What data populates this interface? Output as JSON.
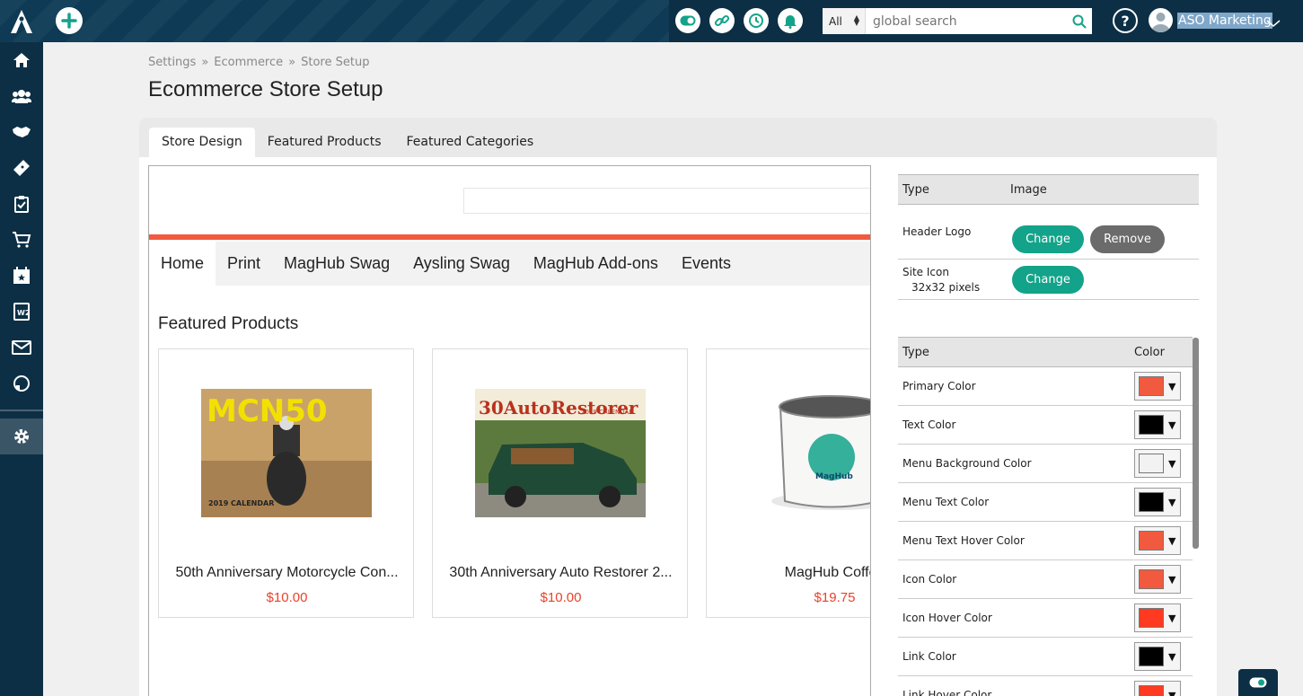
{
  "header": {
    "search_scope": "All",
    "search_placeholder": "global search",
    "user_name": "ASO Marketing",
    "help_label": "?"
  },
  "breadcrumb": [
    "Settings",
    "»",
    "Ecommerce",
    "»",
    "Store Setup"
  ],
  "page_title": "Ecommerce Store Setup",
  "tabs": [
    "Store Design",
    "Featured Products",
    "Featured Categories"
  ],
  "preview": {
    "menu": [
      "Home",
      "Print",
      "MagHub Swag",
      "Aysling Swag",
      "MagHub Add-ons",
      "Events"
    ],
    "heading": "Featured Products",
    "products": [
      {
        "name": "50th Anniversary Motorcycle Con...",
        "price": "$10.00",
        "image_text": "MCN50",
        "image_sub": "2019 CALENDAR"
      },
      {
        "name": "30th Anniversary Auto Restorer 2...",
        "price": "$10.00",
        "image_text": "30AutoRestorer",
        "image_sub": "2019 CALENDAR"
      },
      {
        "name": "MagHub Coffee",
        "price": "$19.75",
        "image_text": "MagHub"
      }
    ]
  },
  "images_table": {
    "col_type": "Type",
    "col_image": "Image",
    "rows": [
      {
        "type": "Header Logo",
        "change": "Change",
        "remove": "Remove"
      },
      {
        "type": "Site Icon",
        "subtext": "32x32 pixels",
        "change": "Change"
      }
    ]
  },
  "colors_table": {
    "col_type": "Type",
    "col_color": "Color",
    "rows": [
      {
        "type": "Primary Color",
        "color": "#f15a3f"
      },
      {
        "type": "Text Color",
        "color": "#000000"
      },
      {
        "type": "Menu Background Color",
        "color": "#f2f2f2"
      },
      {
        "type": "Menu Text Color",
        "color": "#000000"
      },
      {
        "type": "Menu Text Hover Color",
        "color": "#f15a3f"
      },
      {
        "type": "Icon Color",
        "color": "#f15a3f"
      },
      {
        "type": "Icon Hover Color",
        "color": "#ff3a20"
      },
      {
        "type": "Link Color",
        "color": "#000000"
      },
      {
        "type": "Link Hover Color",
        "color": "#ff3a20"
      }
    ]
  },
  "colors": {
    "accent_teal": "#13a38a",
    "brand_navy": "#0c2f45",
    "primary": "#f15a3f"
  }
}
